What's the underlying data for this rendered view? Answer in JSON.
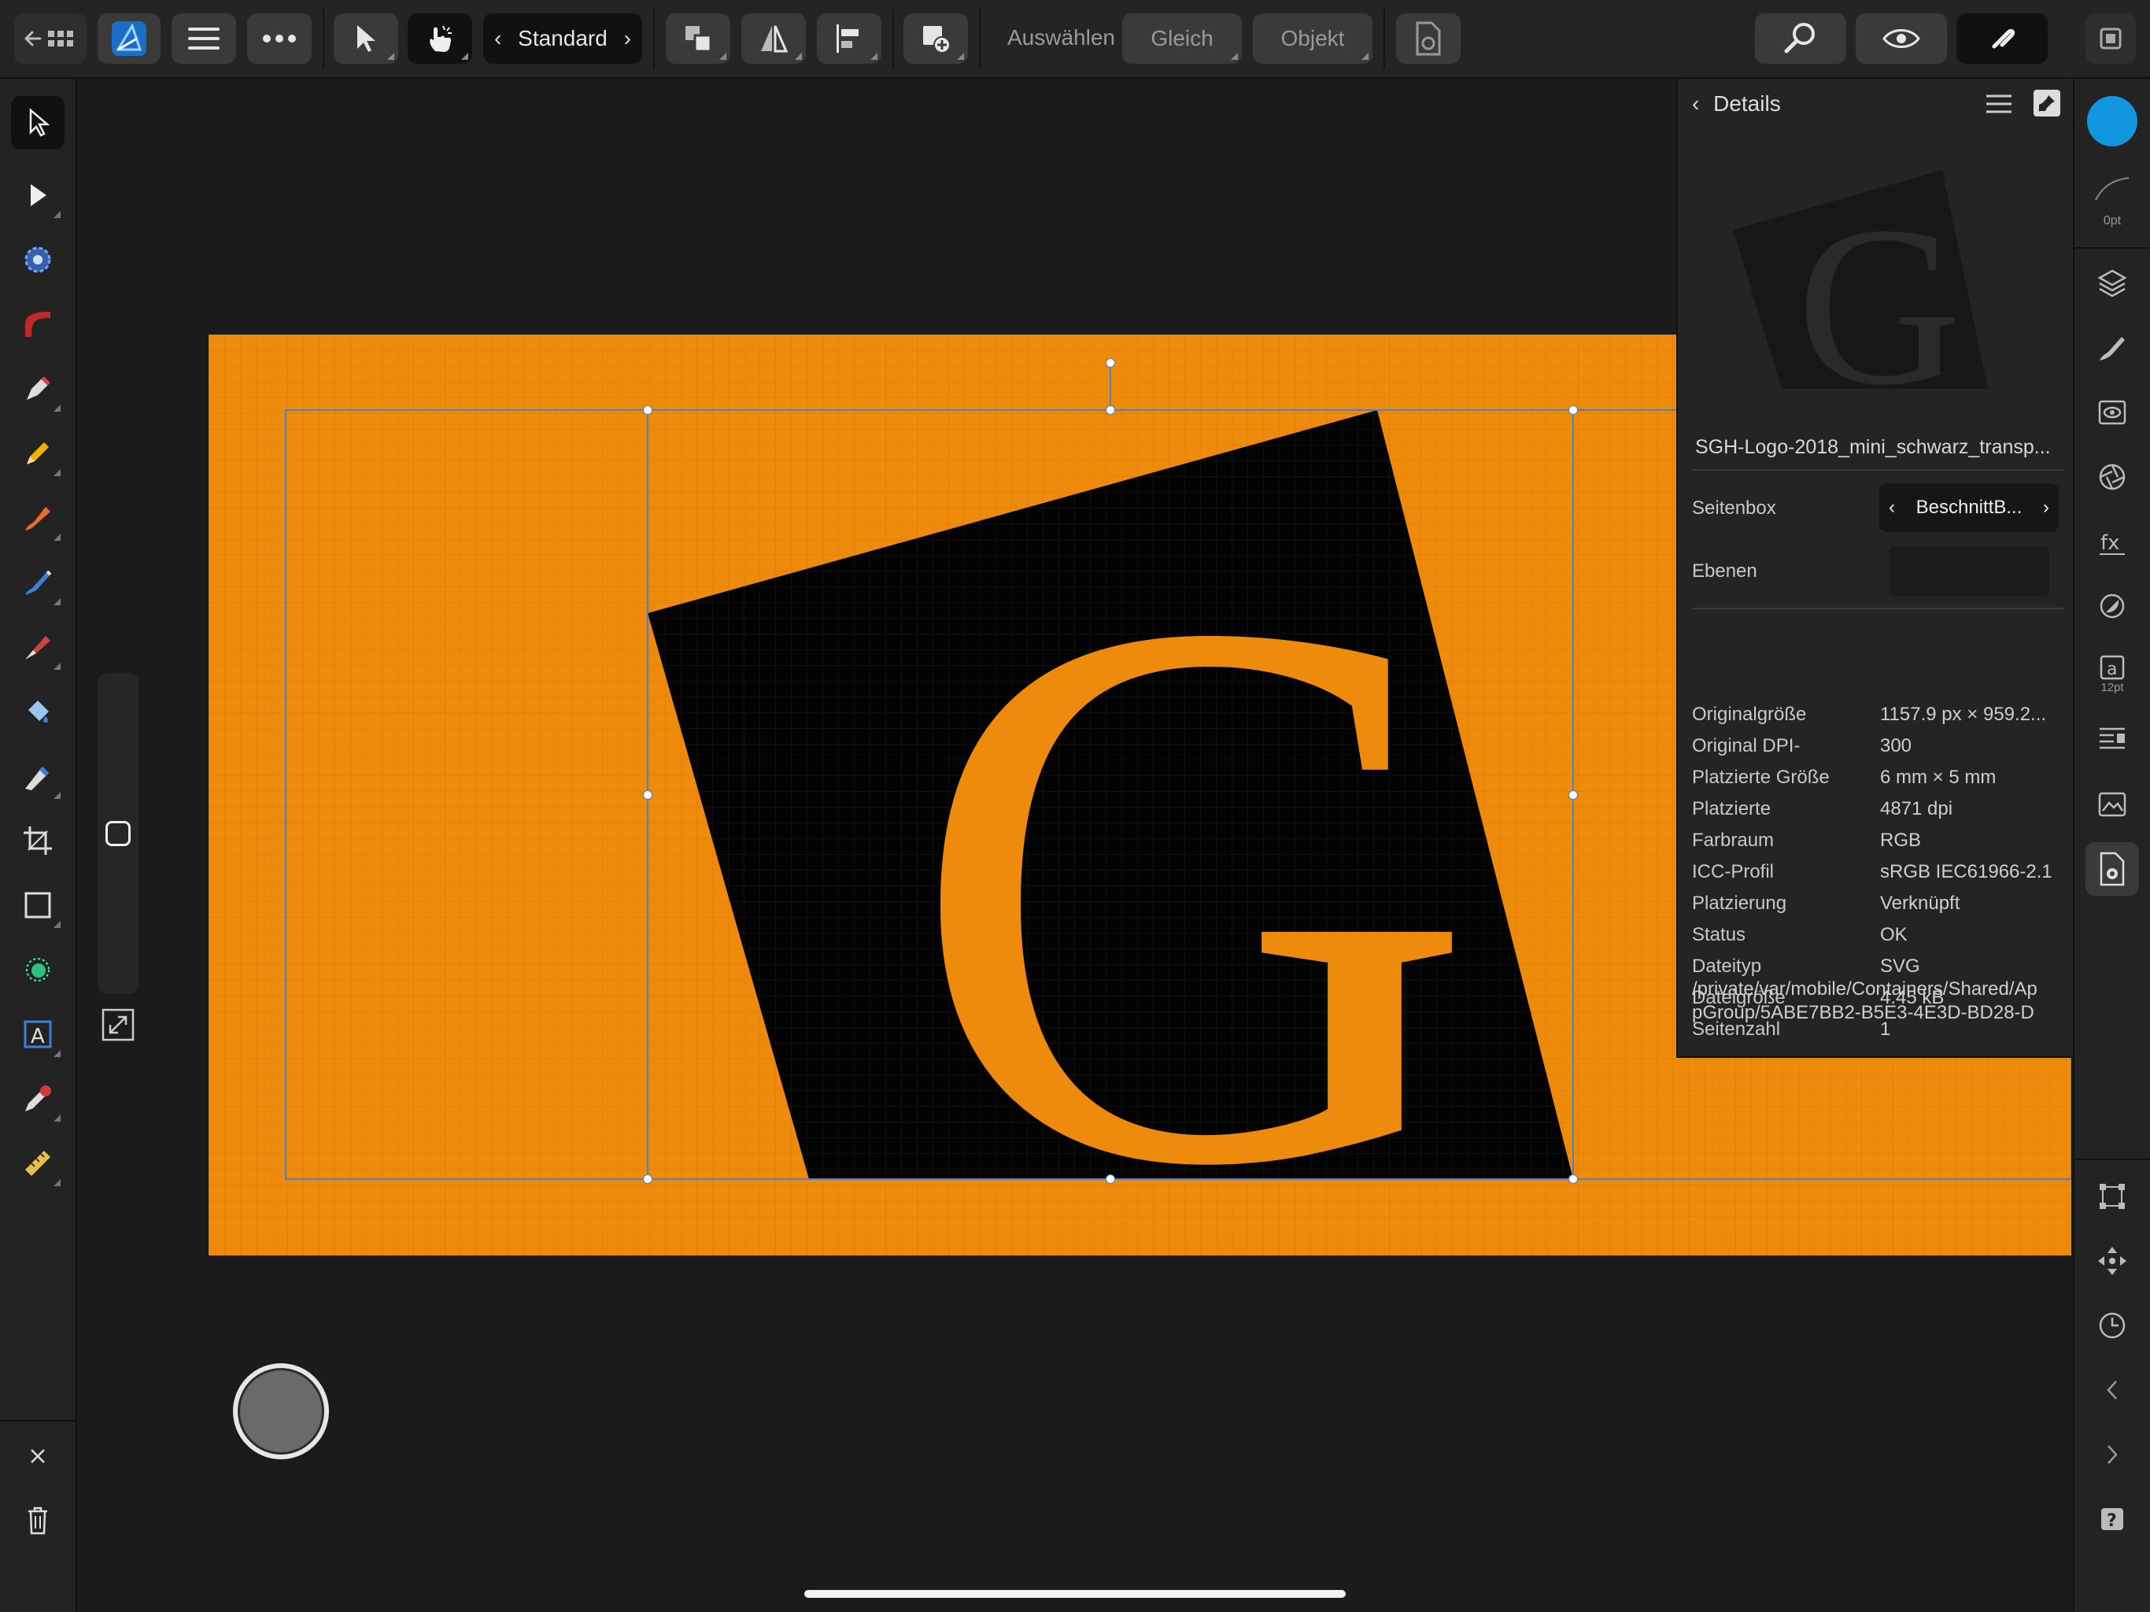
{
  "toolbar": {
    "persona_mode": "Standard",
    "select_label": "Auswählen",
    "same_label": "Gleich",
    "object_label": "Objekt"
  },
  "details": {
    "title": "Details",
    "filename": "SGH-Logo-2018_mini_schwarz_transp...",
    "page_box_label": "Seitenbox",
    "page_box_value": "BeschnittB...",
    "layers_label": "Ebenen",
    "properties": [
      {
        "key": "Originalgröße",
        "value": "1157.9 px × 959.2..."
      },
      {
        "key": "Original DPI-",
        "value": "300"
      },
      {
        "key": "Platzierte Größe",
        "value": "6 mm × 5 mm"
      },
      {
        "key": "Platzierte",
        "value": "4871 dpi"
      },
      {
        "key": "Farbraum",
        "value": "RGB"
      },
      {
        "key": "ICC-Profil",
        "value": "sRGB IEC61966-2.1"
      },
      {
        "key": "Platzierung",
        "value": "Verknüpft"
      },
      {
        "key": "Status",
        "value": "OK"
      },
      {
        "key": "Dateityp",
        "value": "SVG"
      },
      {
        "key": "Dateigröße",
        "value": "4.45 kB"
      },
      {
        "key": "Seitenzahl",
        "value": "1"
      }
    ],
    "path_line1": "/private/var/mobile/Containers/Shared/Ap",
    "path_line2": "pGroup/5ABE7BB2-B5E3-4E3D-BD28-D"
  },
  "rightbar": {
    "stroke_width": "0pt",
    "text_style_size": "12pt"
  },
  "colors": {
    "artboard": "#ee8a0c",
    "fill_swatch": "#1296e0",
    "selection": "#4a82c8"
  },
  "logo": {
    "letter": "G"
  }
}
